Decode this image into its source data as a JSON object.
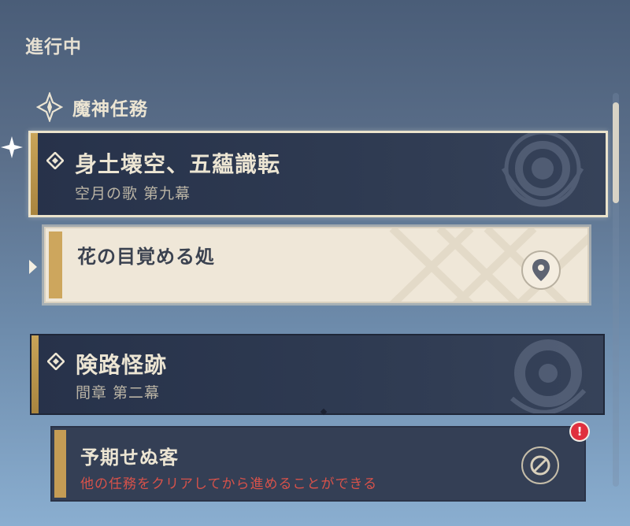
{
  "section": {
    "label": "進行中"
  },
  "category": {
    "label": "魔神任務",
    "icon": "archon-quest-icon"
  },
  "quests": [
    {
      "title": "身土壊空、五蘊識転",
      "subtitle": "空月の歌 第九幕",
      "selected": true,
      "subquest": {
        "title": "花の目覚める処",
        "action_icon": "location-pin-icon"
      }
    },
    {
      "title": "険路怪跡",
      "subtitle": "間章 第二幕",
      "selected": false,
      "subquest": {
        "title": "予期せぬ客",
        "status_text": "他の任務をクリアしてから進めることができる",
        "action_icon": "blocked-icon",
        "badge": "!"
      }
    }
  ],
  "colors": {
    "accent_gold": "#c9a458",
    "warning_red": "#d8524a",
    "badge_red": "#e0303e",
    "panel_dark": "#2f3b52",
    "panel_light": "#efe7d8"
  }
}
